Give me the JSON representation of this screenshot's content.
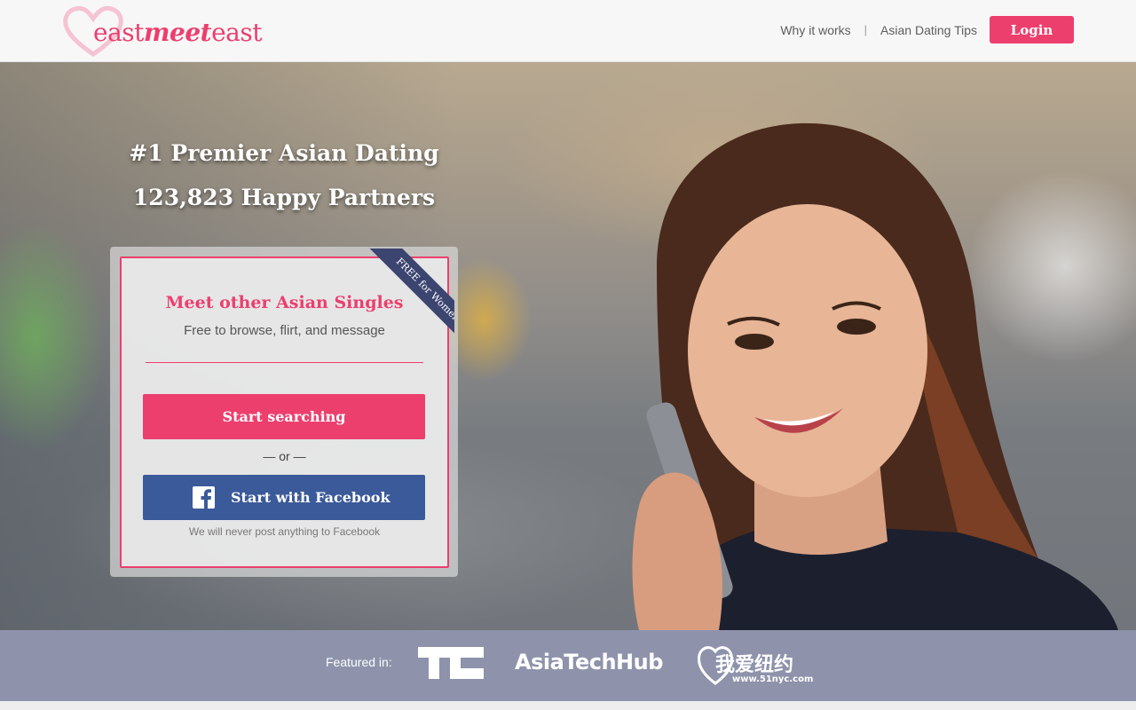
{
  "header": {
    "logo": {
      "part1": "east",
      "part2": "meet",
      "part3": "east"
    },
    "nav": {
      "why_it_works": "Why it works",
      "separator": "|",
      "dating_tips": "Asian Dating Tips",
      "login": "Login"
    }
  },
  "hero": {
    "headline1": "#1 Premier Asian Dating",
    "headline2": "123,823 Happy Partners"
  },
  "signup_card": {
    "ribbon": "FREE for Women",
    "title": "Meet other Asian Singles",
    "subtitle": "Free to browse, flirt, and message",
    "search_button": "Start searching",
    "or_text": "— or —",
    "facebook_button": "Start with Facebook",
    "facebook_note": "We will never post anything to Facebook"
  },
  "featured": {
    "label": "Featured in:",
    "logos": [
      {
        "name": "TechCrunch",
        "text": "TC"
      },
      {
        "name": "AsiaTechHub",
        "text": "AsiaTechHub"
      },
      {
        "name": "51nyc",
        "text": "我爱纽约",
        "url": "www.51nyc.com"
      }
    ]
  },
  "colors": {
    "brand_pink": "#ec3f6e",
    "facebook_blue": "#3b5a9a",
    "ribbon_navy": "#3c4570"
  }
}
